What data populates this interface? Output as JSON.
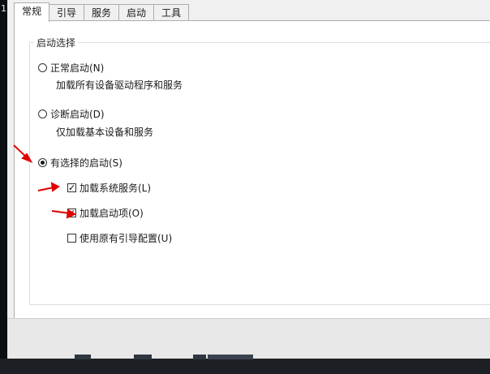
{
  "side_number": "1",
  "tabs": [
    {
      "label": "常规",
      "active": true
    },
    {
      "label": "引导",
      "active": false
    },
    {
      "label": "服务",
      "active": false
    },
    {
      "label": "启动",
      "active": false
    },
    {
      "label": "工具",
      "active": false
    }
  ],
  "startup_group": {
    "legend": "启动选择",
    "normal": {
      "label": "正常启动(N)",
      "desc": "加载所有设备驱动程序和服务",
      "selected": false
    },
    "diagnostic": {
      "label": "诊断启动(D)",
      "desc": "仅加载基本设备和服务",
      "selected": false
    },
    "selective": {
      "label": "有选择的启动(S)",
      "selected": true
    },
    "load_system_services": {
      "label": "加载系统服务(L)",
      "checked": true
    },
    "load_startup_items": {
      "label": "加载启动项(O)",
      "checked": true
    },
    "use_original_boot": {
      "label": "使用原有引导配置(U)",
      "checked": false
    }
  },
  "annotation_color": "#e00000"
}
